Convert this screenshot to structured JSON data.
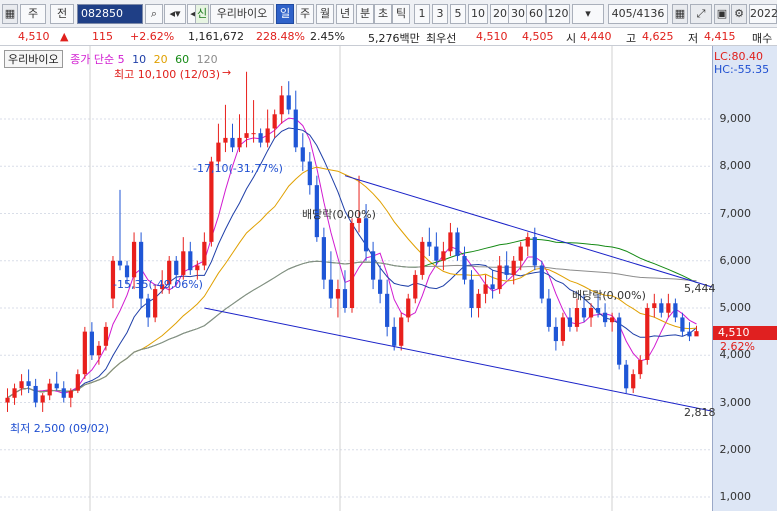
{
  "toolbar": {
    "market": "주",
    "market2": "전",
    "code": "082850",
    "stock_tag": "신",
    "stock_name": "우리바이오",
    "periods": [
      "일",
      "주",
      "월",
      "년",
      "분",
      "초",
      "틱"
    ],
    "active_period": "일",
    "intervals": [
      "1",
      "3",
      "5",
      "10",
      "20",
      "30",
      "60",
      "120"
    ],
    "counter": "405/4136",
    "year": "2022"
  },
  "quote": {
    "price": "4,510",
    "arrow": "▲",
    "change": "115",
    "change_pct": "+2.62%",
    "volume": "1,161,672",
    "volume_ratio": "228.48%",
    "turnover": "2.45%",
    "amount": "5,276백만",
    "best_label": "최우선",
    "best_ask": "4,510",
    "best_bid": "4,505",
    "open_label": "시",
    "open": "4,440",
    "high_label": "고",
    "high": "4,625",
    "low_label": "저",
    "low": "4,415",
    "order_label": "매수"
  },
  "legend": {
    "name": "우리바이오",
    "type": "종가 단순",
    "ma5": "5",
    "ma10": "10",
    "ma20": "20",
    "ma60": "60",
    "ma120": "120",
    "ma5_color": "#d11bd1",
    "ma10_color": "#1f3fa8",
    "ma20_color": "#e0a000",
    "ma60_color": "#158a15",
    "ma120_color": "#8c8c8c"
  },
  "indicators": {
    "lc": "LC:80.40",
    "hc": "HC:-55.35"
  },
  "annotations": {
    "high": "최고 10,100 (12/03)",
    "low": "최저 2,500 (09/02)",
    "drawdown1": "-17,10(-31,77%)",
    "drawdown2": "-15,35(-49,06%)",
    "dividend1": "배당락(0,00%)",
    "dividend2": "배당락(0,00%)",
    "channel_top": "5,444",
    "channel_bottom": "2,818"
  },
  "y_axis": {
    "ticks": [
      "9,000",
      "8,000",
      "7,000",
      "6,000",
      "5,000",
      "4,000",
      "3,000",
      "2,000",
      "1,000"
    ],
    "current_price": "4,510",
    "current_pct": "2.62%"
  },
  "chart_data": {
    "type": "candlestick",
    "ylim": [
      700,
      10300
    ],
    "x_count": 120,
    "candles": [
      [
        3000,
        3300,
        2800,
        3100
      ],
      [
        3100,
        3400,
        2950,
        3300
      ],
      [
        3300,
        3600,
        3150,
        3450
      ],
      [
        3450,
        3700,
        3200,
        3350
      ],
      [
        3350,
        3500,
        2900,
        3000
      ],
      [
        3000,
        3200,
        2800,
        3150
      ],
      [
        3150,
        3500,
        3050,
        3400
      ],
      [
        3400,
        3650,
        3250,
        3300
      ],
      [
        3300,
        3450,
        3000,
        3100
      ],
      [
        3100,
        3300,
        2900,
        3250
      ],
      [
        3250,
        3700,
        3200,
        3600
      ],
      [
        3600,
        4600,
        3500,
        4500
      ],
      [
        4500,
        4700,
        3900,
        4000
      ],
      [
        4000,
        4300,
        3800,
        4200
      ],
      [
        4200,
        4700,
        4100,
        4600
      ],
      [
        5200,
        6100,
        5000,
        6000
      ],
      [
        6000,
        7500,
        5800,
        5900
      ],
      [
        5900,
        6000,
        5500,
        5650
      ],
      [
        5650,
        6600,
        5400,
        6400
      ],
      [
        6400,
        6600,
        5000,
        5200
      ],
      [
        5200,
        5300,
        4600,
        4800
      ],
      [
        4800,
        5500,
        4700,
        5400
      ],
      [
        5400,
        5800,
        5300,
        5500
      ],
      [
        5500,
        6100,
        5300,
        6000
      ],
      [
        6000,
        6100,
        5500,
        5700
      ],
      [
        5700,
        6500,
        5600,
        6200
      ],
      [
        6200,
        6400,
        5700,
        5800
      ],
      [
        5800,
        6000,
        5600,
        5900
      ],
      [
        5900,
        6600,
        5800,
        6400
      ],
      [
        6400,
        8200,
        6300,
        8100
      ],
      [
        8100,
        8900,
        7900,
        8500
      ],
      [
        8500,
        9300,
        8300,
        8600
      ],
      [
        8600,
        8900,
        8300,
        8400
      ],
      [
        8400,
        9100,
        8300,
        8600
      ],
      [
        8600,
        10000,
        8400,
        8700
      ],
      [
        8700,
        9400,
        8500,
        8700
      ],
      [
        8700,
        8800,
        8400,
        8500
      ],
      [
        8500,
        9200,
        8400,
        8800
      ],
      [
        8800,
        9200,
        8600,
        9100
      ],
      [
        9100,
        9700,
        8900,
        9500
      ],
      [
        9500,
        9800,
        9100,
        9200
      ],
      [
        9200,
        9600,
        8300,
        8400
      ],
      [
        8400,
        8700,
        7900,
        8100
      ],
      [
        8100,
        8300,
        7400,
        7600
      ],
      [
        7600,
        7800,
        6400,
        6500
      ],
      [
        6500,
        6700,
        5400,
        5600
      ],
      [
        5600,
        6200,
        5000,
        5200
      ],
      [
        5200,
        5600,
        4800,
        5400
      ],
      [
        5400,
        5800,
        4900,
        5000
      ],
      [
        5000,
        6900,
        4900,
        6800
      ],
      [
        6800,
        7800,
        6600,
        6900
      ],
      [
        6900,
        7200,
        6000,
        6200
      ],
      [
        6200,
        6400,
        5400,
        5600
      ],
      [
        5600,
        5900,
        5100,
        5300
      ],
      [
        5300,
        5600,
        4400,
        4600
      ],
      [
        4600,
        4800,
        4100,
        4200
      ],
      [
        4200,
        4900,
        4100,
        4800
      ],
      [
        4800,
        5300,
        4700,
        5200
      ],
      [
        5200,
        5800,
        5100,
        5700
      ],
      [
        5700,
        6500,
        5600,
        6400
      ],
      [
        6400,
        6700,
        6100,
        6300
      ],
      [
        6300,
        6600,
        5900,
        6000
      ],
      [
        6000,
        6400,
        5800,
        6200
      ],
      [
        6200,
        6800,
        6100,
        6600
      ],
      [
        6600,
        6700,
        6000,
        6100
      ],
      [
        6100,
        6300,
        5500,
        5600
      ],
      [
        5600,
        5800,
        4800,
        5000
      ],
      [
        5000,
        5400,
        4800,
        5300
      ],
      [
        5300,
        5700,
        5100,
        5500
      ],
      [
        5500,
        5800,
        5200,
        5400
      ],
      [
        5400,
        6100,
        5300,
        5900
      ],
      [
        5900,
        6200,
        5600,
        5700
      ],
      [
        5700,
        6100,
        5500,
        6000
      ],
      [
        6000,
        6400,
        5800,
        6300
      ],
      [
        6300,
        6600,
        6100,
        6500
      ],
      [
        6500,
        6700,
        5800,
        5900
      ],
      [
        5900,
        6000,
        5100,
        5200
      ],
      [
        5200,
        5400,
        4500,
        4600
      ],
      [
        4600,
        4800,
        4100,
        4300
      ],
      [
        4300,
        4900,
        4200,
        4800
      ],
      [
        4800,
        5000,
        4500,
        4600
      ],
      [
        4600,
        5200,
        4500,
        5000
      ],
      [
        5000,
        5300,
        4700,
        4800
      ],
      [
        4800,
        5100,
        4600,
        5000
      ],
      [
        5000,
        5300,
        4800,
        4900
      ],
      [
        4900,
        5100,
        4600,
        4700
      ],
      [
        4700,
        4900,
        4500,
        4800
      ],
      [
        4800,
        4900,
        3700,
        3800
      ],
      [
        3800,
        3900,
        3200,
        3300
      ],
      [
        3300,
        3700,
        3200,
        3600
      ],
      [
        3600,
        4000,
        3500,
        3900
      ],
      [
        3900,
        5100,
        3800,
        5000
      ],
      [
        5000,
        5300,
        4800,
        5100
      ],
      [
        5100,
        5200,
        4800,
        4900
      ],
      [
        4900,
        5300,
        4800,
        5100
      ],
      [
        5100,
        5200,
        4700,
        4800
      ],
      [
        4800,
        4900,
        4400,
        4500
      ],
      [
        4500,
        4700,
        4300,
        4400
      ],
      [
        4400,
        4625,
        4415,
        4510
      ]
    ]
  }
}
